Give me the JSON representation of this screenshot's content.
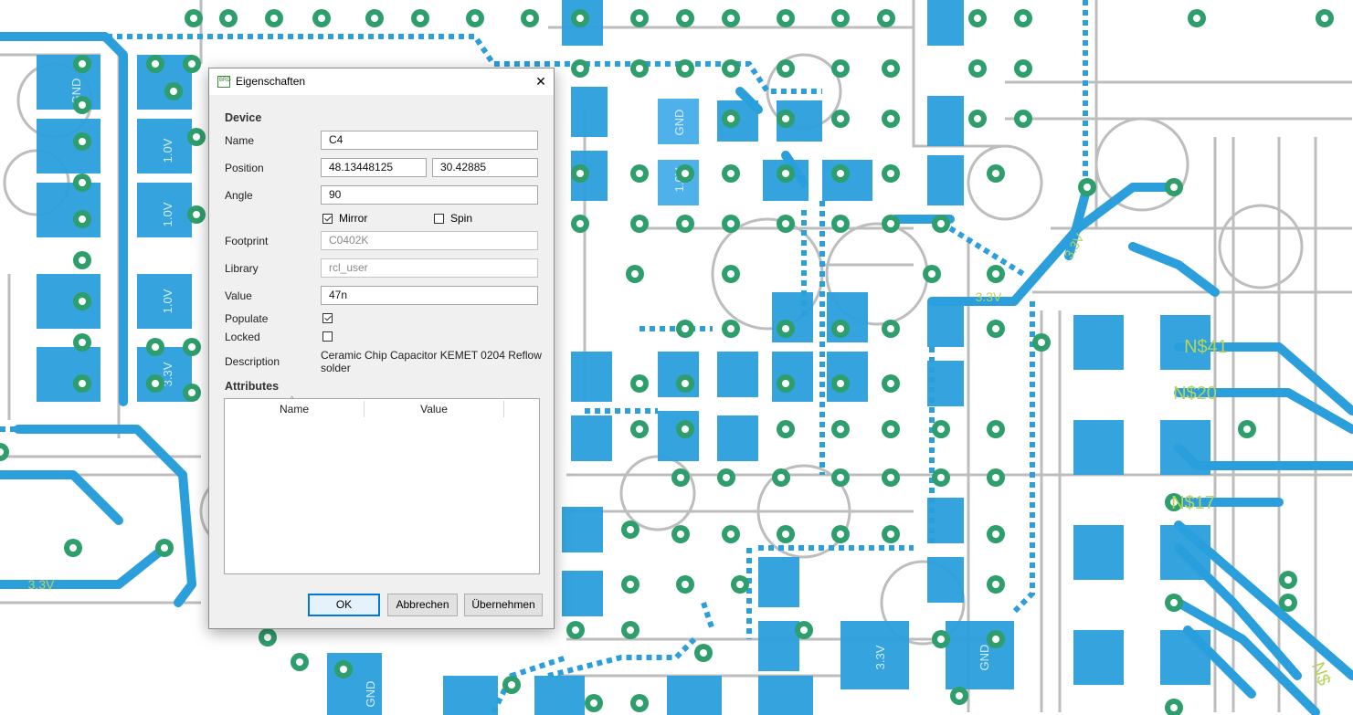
{
  "board": {
    "net_labels": [
      "3.3V",
      "3.3V",
      "3.3V",
      "N$41",
      "N$20",
      "N$17",
      "N$"
    ],
    "pad_labels": [
      "GND",
      "1.0V",
      "1.0V",
      "1.0V",
      "1.0V",
      "GND",
      "3.3V",
      "GND",
      "GND",
      "3.3V"
    ],
    "colors": {
      "copper": "#2a9fdc",
      "via": "#2e9e6c",
      "silkscreen": "#b4b4b4",
      "background": "#ffffff"
    }
  },
  "dialog": {
    "app_icon": "BRD",
    "title": "Eigenschaften",
    "close_icon": "close-icon",
    "device_heading": "Device",
    "name_label": "Name",
    "name_value": "C4",
    "position_label": "Position",
    "position_x": "48.13448125",
    "position_y": "30.42885",
    "angle_label": "Angle",
    "angle_value": "90",
    "mirror_label": "Mirror",
    "mirror_checked": true,
    "spin_label": "Spin",
    "spin_checked": false,
    "footprint_label": "Footprint",
    "footprint_value": "C0402K",
    "library_label": "Library",
    "library_value": "rcl_user",
    "value_label": "Value",
    "value_value": "47n",
    "populate_label": "Populate",
    "populate_checked": true,
    "locked_label": "Locked",
    "locked_checked": false,
    "description_label": "Description",
    "description_value": "Ceramic Chip Capacitor KEMET 0204 Reflow solder",
    "attributes_heading": "Attributes",
    "attr_col_name": "Name",
    "attr_col_value": "Value",
    "attributes": [],
    "ok_button": "OK",
    "cancel_button": "Abbrechen",
    "apply_button": "Übernehmen"
  }
}
